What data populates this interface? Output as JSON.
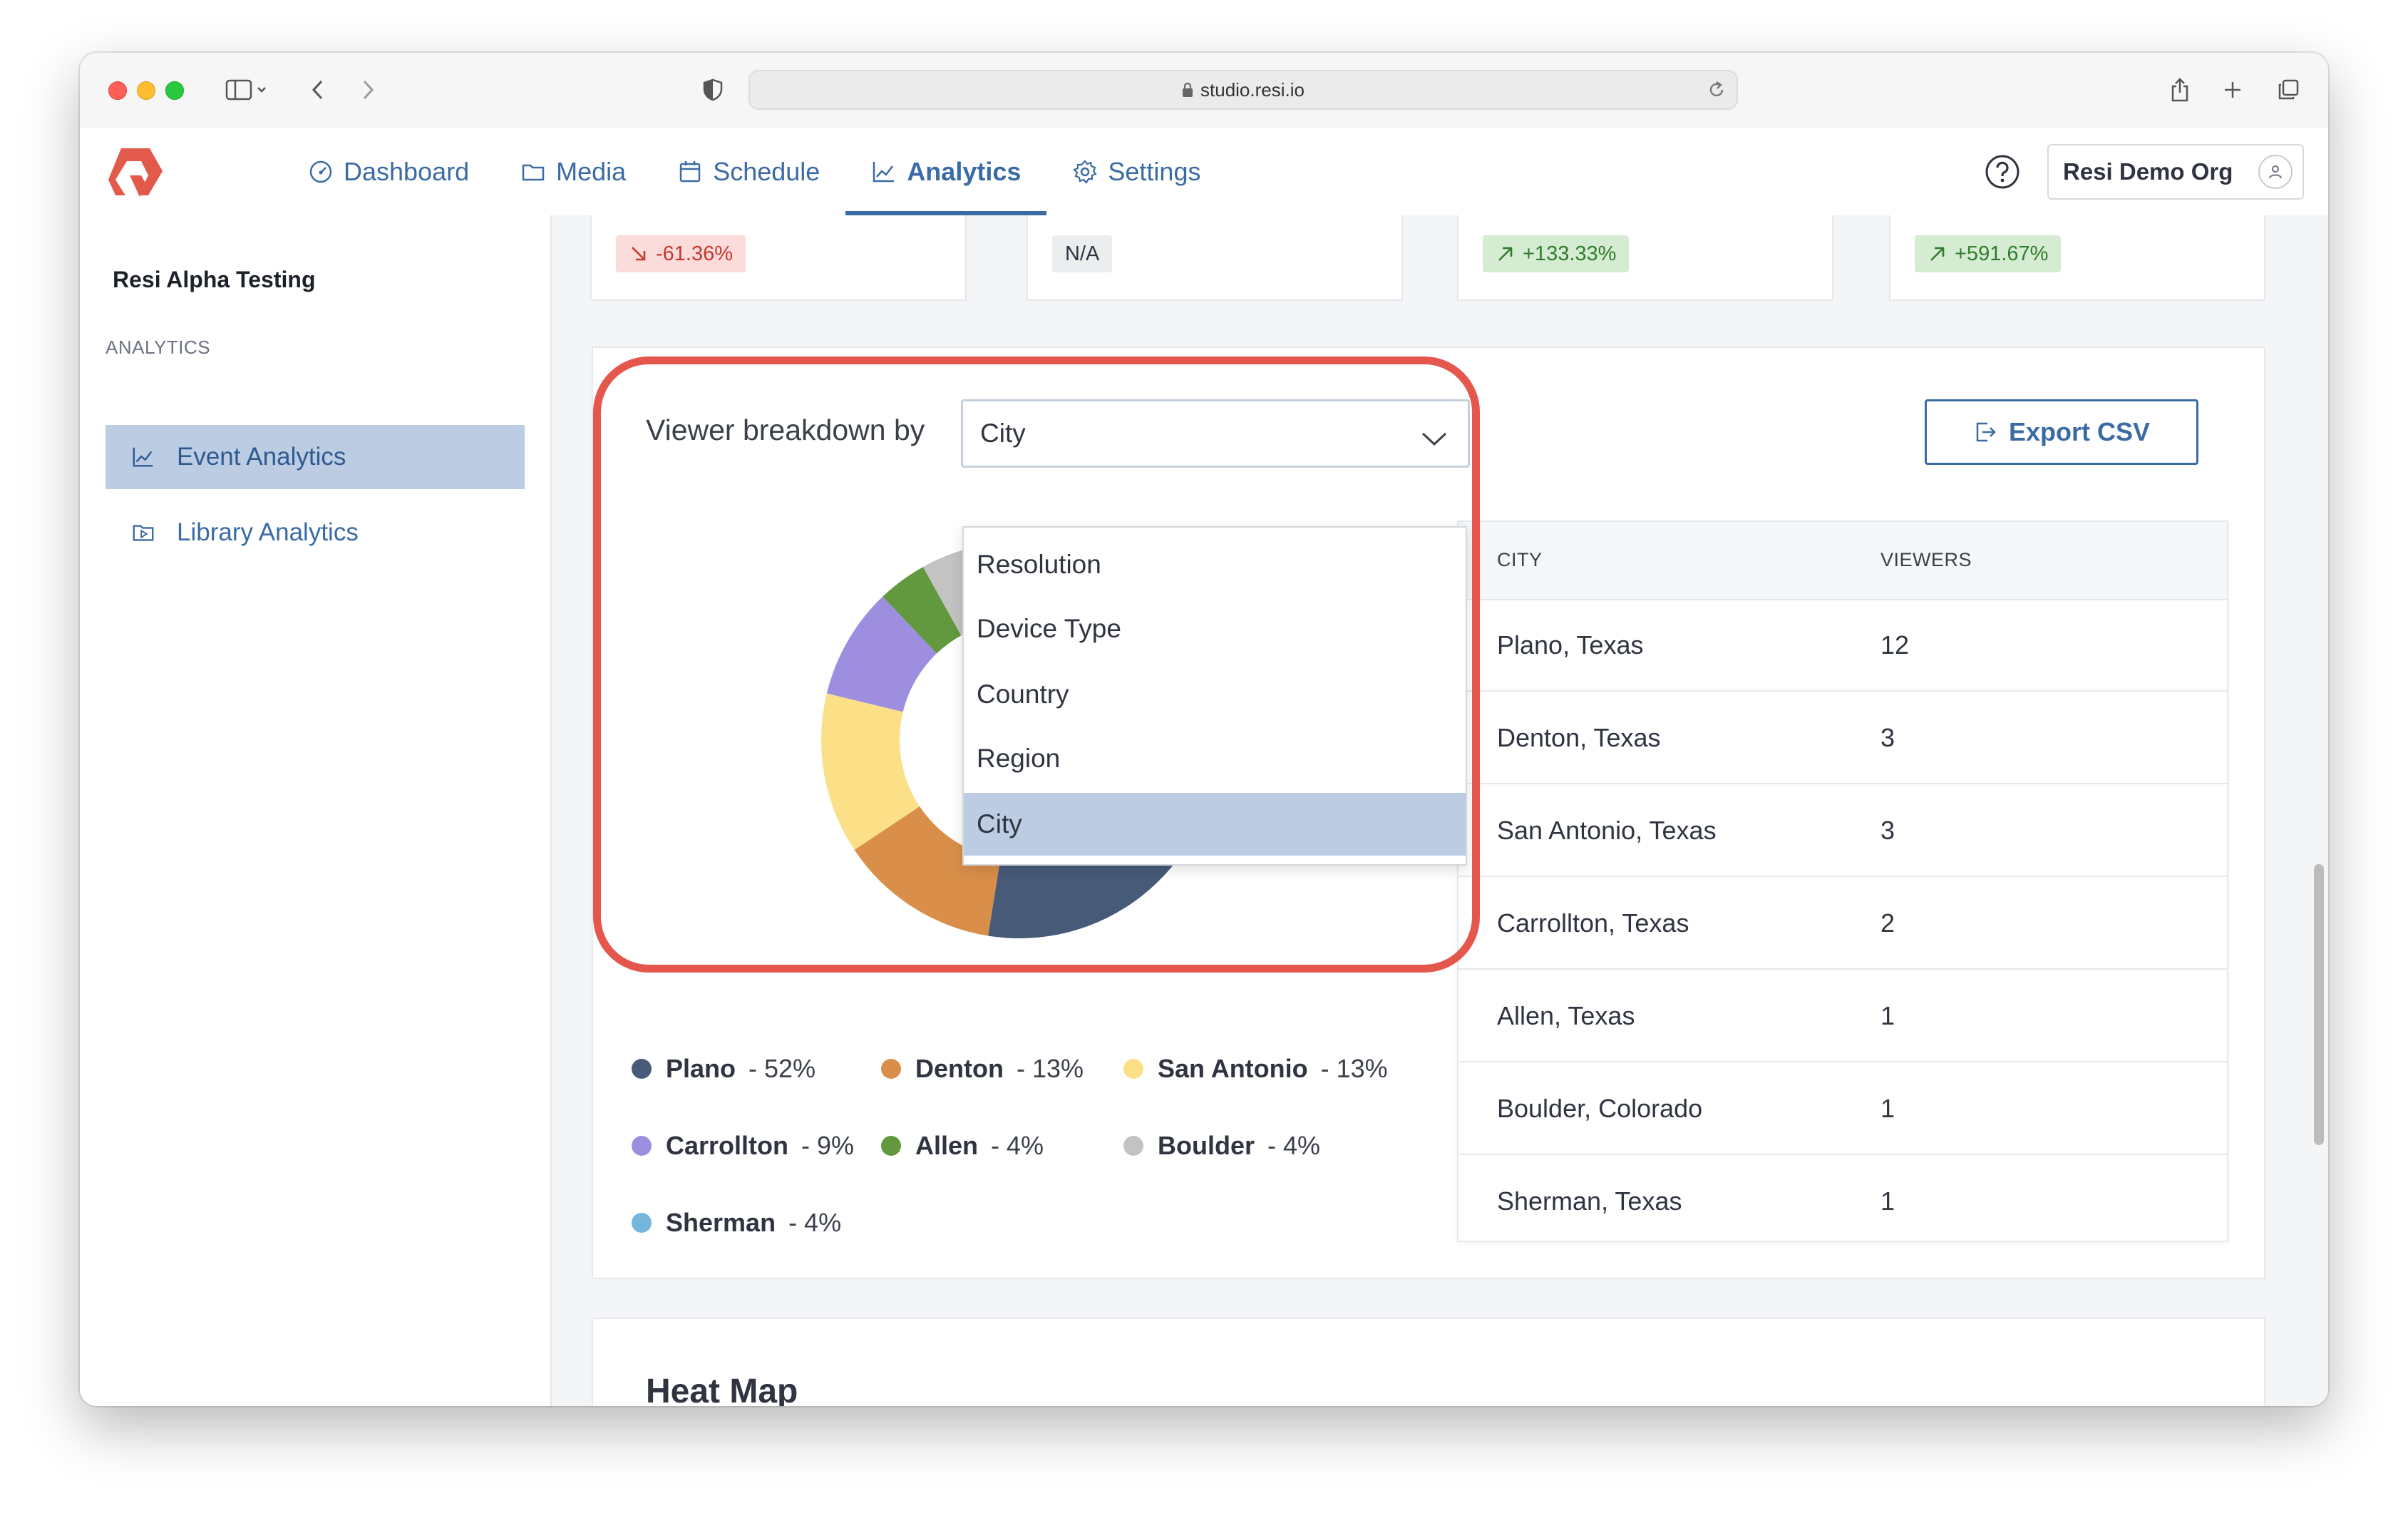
{
  "browser": {
    "url": "studio.resi.io"
  },
  "app": {
    "nav": [
      {
        "label": "Dashboard",
        "icon": "dashboard-icon"
      },
      {
        "label": "Media",
        "icon": "folder-icon"
      },
      {
        "label": "Schedule",
        "icon": "calendar-icon"
      },
      {
        "label": "Analytics",
        "icon": "chart-line-icon",
        "active": true
      },
      {
        "label": "Settings",
        "icon": "gear-icon"
      }
    ],
    "org_button": "Resi Demo Org"
  },
  "sidebar": {
    "org_name": "Resi Alpha Testing",
    "section_label": "ANALYTICS",
    "items": [
      {
        "label": "Event Analytics",
        "active": true
      },
      {
        "label": "Library Analytics",
        "active": false
      }
    ]
  },
  "stats": [
    {
      "change": "-61.36%",
      "trend": "down"
    },
    {
      "change": "N/A",
      "trend": "neutral"
    },
    {
      "change": "+133.33%",
      "trend": "up"
    },
    {
      "change": "+591.67%",
      "trend": "up"
    }
  ],
  "breakdown": {
    "label": "Viewer breakdown by",
    "selected": "City",
    "options": [
      "Resolution",
      "Device Type",
      "Country",
      "Region",
      "City"
    ],
    "export_label": "Export CSV"
  },
  "chart_data": {
    "type": "pie",
    "variant": "donut",
    "categories": [
      "Plano",
      "Denton",
      "San Antonio",
      "Carrollton",
      "Allen",
      "Boulder",
      "Sherman"
    ],
    "values": [
      52,
      13,
      13,
      9,
      4,
      4,
      4
    ],
    "value_labels": [
      "52%",
      "13%",
      "13%",
      "9%",
      "4%",
      "4%",
      "4%"
    ],
    "colors": [
      "#475a78",
      "#d98f49",
      "#fbe088",
      "#9d8ee0",
      "#62993f",
      "#c3c3c3",
      "#74b6de"
    ]
  },
  "table": {
    "headers": [
      "CITY",
      "VIEWERS"
    ],
    "rows": [
      {
        "city": "Plano, Texas",
        "viewers": "12"
      },
      {
        "city": "Denton, Texas",
        "viewers": "3"
      },
      {
        "city": "San Antonio, Texas",
        "viewers": "3"
      },
      {
        "city": "Carrollton, Texas",
        "viewers": "2"
      },
      {
        "city": "Allen, Texas",
        "viewers": "1"
      },
      {
        "city": "Boulder, Colorado",
        "viewers": "1"
      },
      {
        "city": "Sherman, Texas",
        "viewers": "1"
      }
    ]
  },
  "heatmap": {
    "title": "Heat Map"
  }
}
